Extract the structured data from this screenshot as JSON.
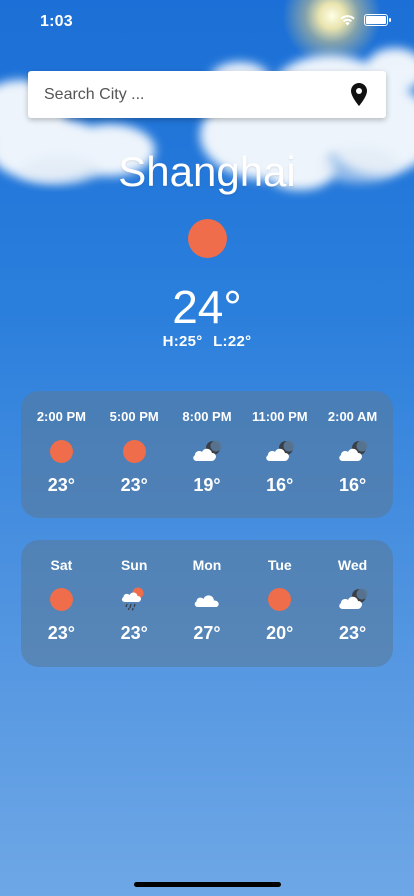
{
  "status_bar": {
    "time": "1:03"
  },
  "search": {
    "placeholder": "Search City ..."
  },
  "current": {
    "city": "Shanghai",
    "temperature": "24°",
    "high": "H:25°",
    "low": "L:22°",
    "icon": "sun-icon"
  },
  "hourly": [
    {
      "time": "2:00 PM",
      "icon": "sun-icon",
      "temp": "23°"
    },
    {
      "time": "5:00 PM",
      "icon": "sun-icon",
      "temp": "23°"
    },
    {
      "time": "8:00 PM",
      "icon": "cloudy-night-icon",
      "temp": "19°"
    },
    {
      "time": "11:00 PM",
      "icon": "cloudy-night-icon",
      "temp": "16°"
    },
    {
      "time": "2:00 AM",
      "icon": "cloudy-night-icon",
      "temp": "16°"
    }
  ],
  "daily": [
    {
      "day": "Sat",
      "icon": "sun-icon",
      "temp": "23°"
    },
    {
      "day": "Sun",
      "icon": "rain-sun-cloud-icon",
      "temp": "23°"
    },
    {
      "day": "Mon",
      "icon": "cloud-icon",
      "temp": "27°"
    },
    {
      "day": "Tue",
      "icon": "sun-icon",
      "temp": "20°"
    },
    {
      "day": "Wed",
      "icon": "cloudy-night-icon",
      "temp": "23°"
    }
  ],
  "colors": {
    "sun": "#ef6d4a",
    "card": "#5a7896",
    "sky_top": "#1b6fd6",
    "sky_bottom": "#6ea7e6"
  }
}
